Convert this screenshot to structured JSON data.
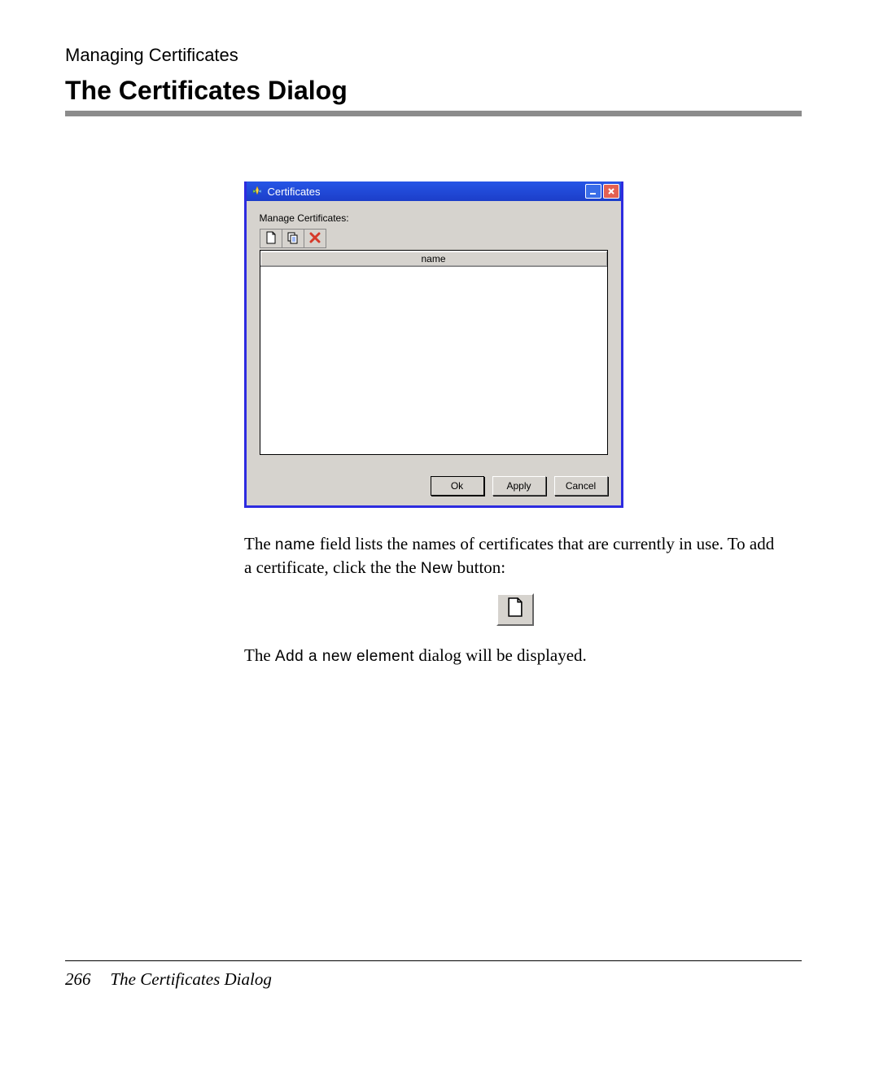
{
  "doc": {
    "section_header": "Managing Certificates",
    "section_title": "The Certificates Dialog",
    "para1_prefix": "The ",
    "para1_code1": "name",
    "para1_mid": " field lists the names of certificates that are currently in use. To add a certificate, click the the ",
    "para1_code2": "New",
    "para1_suffix": " button:",
    "para2_prefix": "The ",
    "para2_code": "Add a new element",
    "para2_suffix": " dialog will be displayed.",
    "page_number": "266",
    "footer_title": "The Certificates Dialog"
  },
  "dialog": {
    "title": "Certificates",
    "label": "Manage Certificates:",
    "column_header": "name",
    "buttons": {
      "ok": "Ok",
      "apply": "Apply",
      "cancel": "Cancel"
    },
    "toolbar_icons": {
      "new": "new-document-icon",
      "copy": "copy-icon",
      "delete": "delete-x-icon"
    }
  }
}
